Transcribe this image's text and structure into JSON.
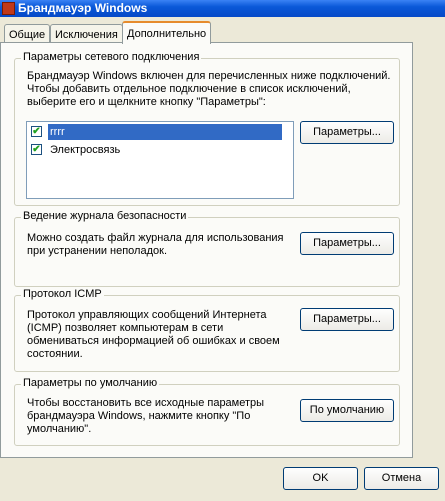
{
  "window": {
    "title": "Брандмауэр Windows"
  },
  "tabs": [
    {
      "label": "Общие",
      "active": false
    },
    {
      "label": "Исключения",
      "active": false
    },
    {
      "label": "Дополнительно",
      "active": true
    }
  ],
  "network": {
    "legend": "Параметры сетевого подключения",
    "description": "Брандмауэр Windows включен для перечисленных ниже подключений. Чтобы добавить отдельное подключение в список исключений, выберите его и щелкните кнопку \"Параметры\":",
    "connections": [
      {
        "label": "rrrr",
        "checked": true,
        "selected": true
      },
      {
        "label": "Электросвязь",
        "checked": true,
        "selected": false
      }
    ],
    "button_label": "Параметры..."
  },
  "logging": {
    "legend": "Ведение журнала безопасности",
    "description": "Можно создать файл журнала для использования при устранении неполадок.",
    "button_label": "Параметры..."
  },
  "icmp": {
    "legend": "Протокол ICMP",
    "description": "Протокол управляющих сообщений Интернета (ICMP) позволяет компьютерам в сети обмениваться информацией об ошибках и своем состоянии.",
    "button_label": "Параметры..."
  },
  "defaults": {
    "legend": "Параметры по умолчанию",
    "description": "Чтобы восстановить все исходные параметры брандмауэра Windows, нажмите кнопку \"По умолчанию\".",
    "button_label": "По умолчанию"
  },
  "footer": {
    "ok_label": "OK",
    "cancel_label": "Отмена"
  },
  "colors": {
    "titlebar": "#0a58d8",
    "tab_highlight": "#e68b2c",
    "selection": "#316ac5",
    "face": "#ece9d8"
  }
}
